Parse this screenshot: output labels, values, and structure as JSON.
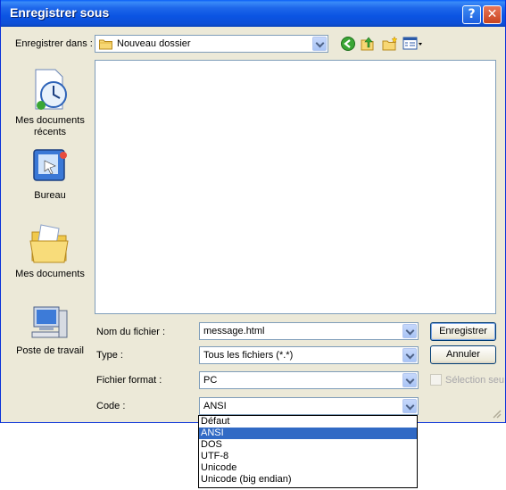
{
  "window": {
    "title": "Enregistrer sous"
  },
  "savein": {
    "label": "Enregistrer dans :",
    "value": "Nouveau dossier"
  },
  "places": [
    {
      "label": "Mes documents récents",
      "icon": "recent-documents-icon"
    },
    {
      "label": "Bureau",
      "icon": "desktop-icon"
    },
    {
      "label": "Mes documents",
      "icon": "my-documents-icon"
    },
    {
      "label": "Poste de travail",
      "icon": "my-computer-icon"
    }
  ],
  "form": {
    "filename_label": "Nom du fichier :",
    "filename_value": "message.html",
    "type_label": "Type :",
    "type_value": "Tous les fichiers (*.*)",
    "format_label": "Fichier format :",
    "format_value": "PC",
    "code_label": "Code :",
    "code_value": "ANSI"
  },
  "buttons": {
    "save": "Enregistrer",
    "cancel": "Annuler"
  },
  "selection_only_label": "Sélection seu",
  "code_options": [
    {
      "label": "Défaut",
      "selected": false
    },
    {
      "label": "ANSI",
      "selected": true
    },
    {
      "label": "DOS",
      "selected": false
    },
    {
      "label": "UTF-8",
      "selected": false
    },
    {
      "label": "Unicode",
      "selected": false
    },
    {
      "label": "Unicode (big endian)",
      "selected": false
    }
  ],
  "colors": {
    "titlebar": "#0b54e3",
    "dialog_bg": "#ece9d8",
    "selection": "#316ac5"
  }
}
